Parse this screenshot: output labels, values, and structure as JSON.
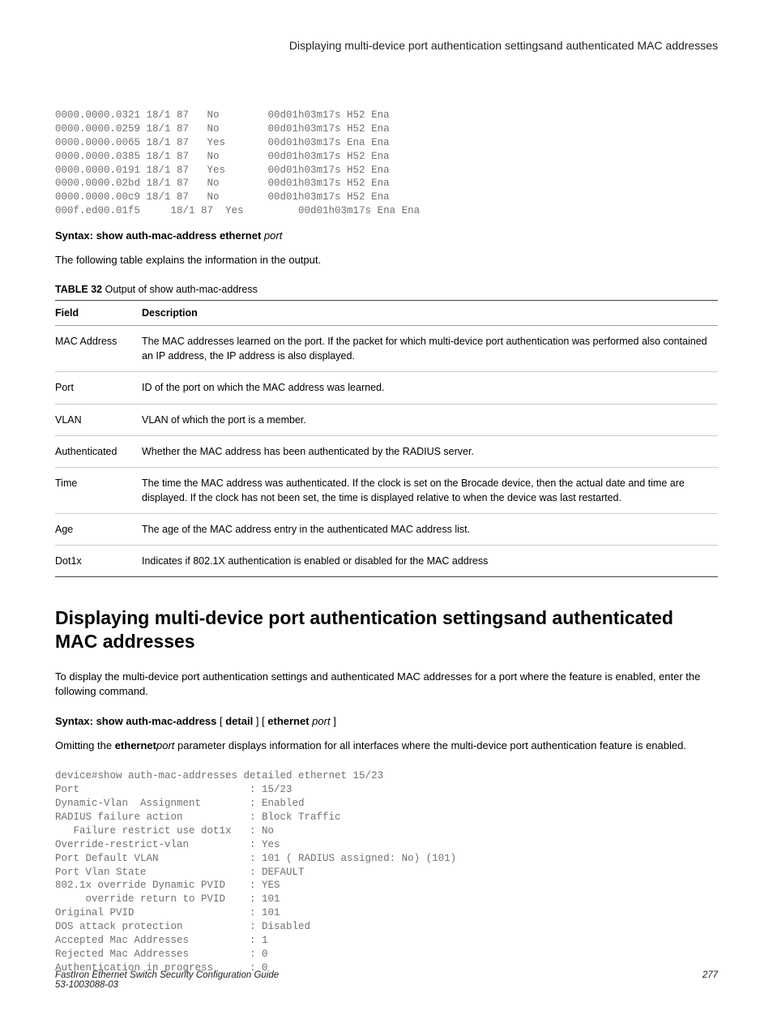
{
  "header": {
    "title": "Displaying multi-device port authentication settingsand authenticated MAC addresses"
  },
  "code_block_1": "0000.0000.0321 18/1 87   No        00d01h03m17s H52 Ena\n0000.0000.0259 18/1 87   No        00d01h03m17s H52 Ena\n0000.0000.0065 18/1 87   Yes       00d01h03m17s Ena Ena\n0000.0000.0385 18/1 87   No        00d01h03m17s H52 Ena\n0000.0000.0191 18/1 87   Yes       00d01h03m17s H52 Ena\n0000.0000.02bd 18/1 87   No        00d01h03m17s H52 Ena\n0000.0000.00c9 18/1 87   No        00d01h03m17s H52 Ena\n000f.ed00.01f5     18/1 87  Yes         00d01h03m17s Ena Ena",
  "syntax1": {
    "bold": "Syntax: show auth-mac-address ethernet ",
    "ital": "port"
  },
  "para1": "The following table explains the information in the output.",
  "table_caption": {
    "bold": "TABLE 32",
    "rest": "   Output of show auth-mac-address"
  },
  "table": {
    "head_field": "Field",
    "head_desc": "Description",
    "rows": [
      {
        "field": "MAC Address",
        "desc": "The MAC addresses learned on the port. If the packet for which multi-device port authentication was performed also contained an IP address, the IP address is also displayed."
      },
      {
        "field": "Port",
        "desc": "ID of the port on which the MAC address was learned."
      },
      {
        "field": "VLAN",
        "desc": "VLAN of which the port is a member."
      },
      {
        "field": "Authenticated",
        "desc": "Whether the MAC address has been authenticated by the RADIUS server."
      },
      {
        "field": "Time",
        "desc": "The time the MAC address was authenticated. If the clock is set on the Brocade device, then the actual date and time are displayed. If the clock has not been set, the time is displayed relative to when the device was last restarted."
      },
      {
        "field": "Age",
        "desc": "The age of the MAC address entry in the authenticated MAC address list."
      },
      {
        "field": "Dot1x",
        "desc": "Indicates if 802.1X authentication is enabled or disabled for the MAC address"
      }
    ]
  },
  "section_heading": "Displaying multi-device port authentication settingsand authenticated MAC addresses",
  "para2": "To display the multi-device port authentication settings and authenticated MAC addresses for a port where the feature is enabled, enter the following command.",
  "syntax2": {
    "bold1": "Syntax: show auth-mac-address",
    "plain1": " [ ",
    "bold2": "detail",
    "plain2": " ] [ ",
    "bold3": "ethernet",
    "ital": " port",
    "plain3": " ]"
  },
  "para3_pre": "Omitting the ",
  "para3_bold": "ethernet",
  "para3_ital": "port",
  "para3_post": " parameter displays information for all interfaces where the multi-device port authentication feature is enabled.",
  "code_block_2": "device#show auth-mac-addresses detailed ethernet 15/23\nPort                            : 15/23\nDynamic-Vlan  Assignment        : Enabled\nRADIUS failure action           : Block Traffic\n   Failure restrict use dot1x   : No\nOverride-restrict-vlan          : Yes\nPort Default VLAN               : 101 ( RADIUS assigned: No) (101)\nPort Vlan State                 : DEFAULT\n802.1x override Dynamic PVID    : YES\n     override return to PVID    : 101\nOriginal PVID                   : 101\nDOS attack protection           : Disabled\nAccepted Mac Addresses          : 1\nRejected Mac Addresses          : 0\nAuthentication in progress      : 0",
  "footer": {
    "left_line1": "FastIron Ethernet Switch Security Configuration Guide",
    "left_line2": "53-1003088-03",
    "right": "277"
  }
}
